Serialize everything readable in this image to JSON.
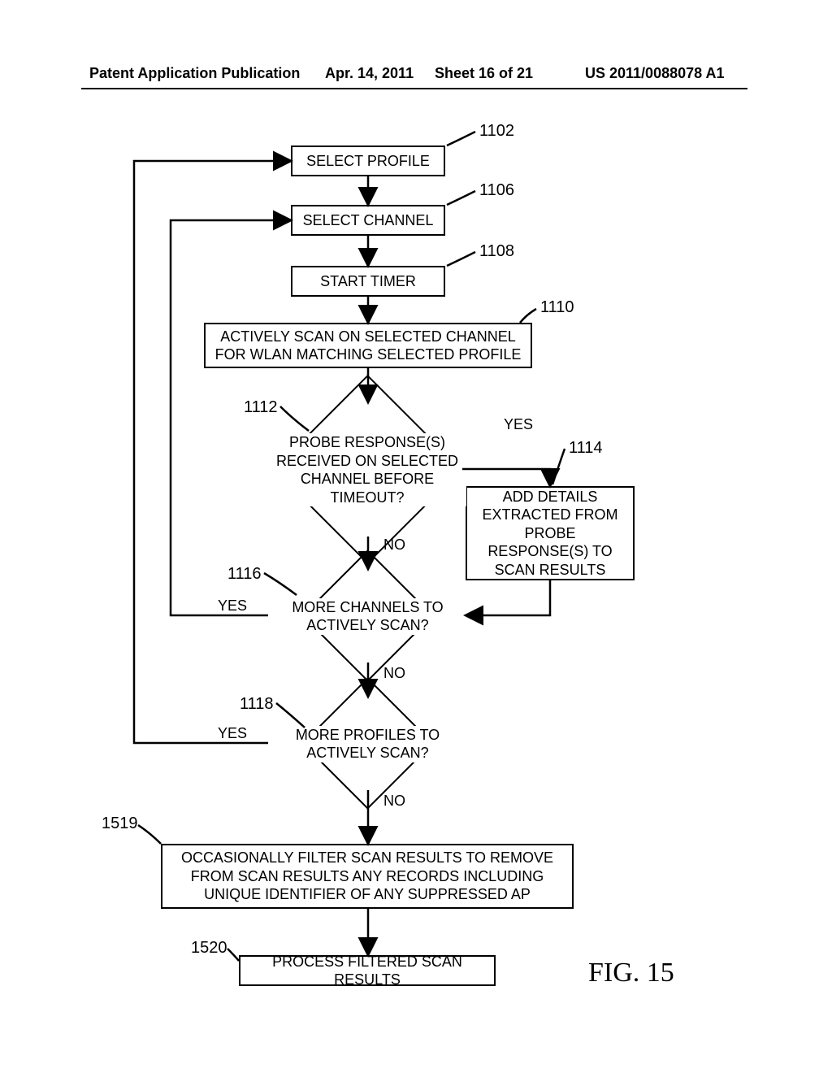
{
  "header": {
    "pubtype": "Patent Application Publication",
    "date": "Apr. 14, 2011",
    "sheet": "Sheet 16 of 21",
    "docno": "US 2011/0088078 A1"
  },
  "figure_label": "FIG. 15",
  "refs": {
    "r1102": "1102",
    "r1106": "1106",
    "r1108": "1108",
    "r1110": "1110",
    "r1112": "1112",
    "r1114": "1114",
    "r1116": "1116",
    "r1118": "1118",
    "r1519": "1519",
    "r1520": "1520"
  },
  "labels": {
    "yes": "YES",
    "no": "NO"
  },
  "steps": {
    "select_profile": "SELECT PROFILE",
    "select_channel": "SELECT CHANNEL",
    "start_timer": "START TIMER",
    "active_scan": "ACTIVELY SCAN ON SELECTED CHANNEL FOR WLAN MATCHING SELECTED PROFILE",
    "probe_q": "PROBE RESPONSE(S) RECEIVED ON SELECTED CHANNEL BEFORE TIMEOUT?",
    "add_details": "ADD DETAILS EXTRACTED FROM PROBE RESPONSE(S) TO SCAN RESULTS",
    "more_channels": "MORE CHANNELS TO ACTIVELY SCAN?",
    "more_profiles": "MORE PROFILES TO ACTIVELY SCAN?",
    "filter": "OCCASIONALLY FILTER SCAN RESULTS TO REMOVE FROM SCAN RESULTS ANY RECORDS INCLUDING UNIQUE IDENTIFIER OF ANY SUPPRESSED AP",
    "process": "PROCESS FILTERED SCAN RESULTS"
  }
}
